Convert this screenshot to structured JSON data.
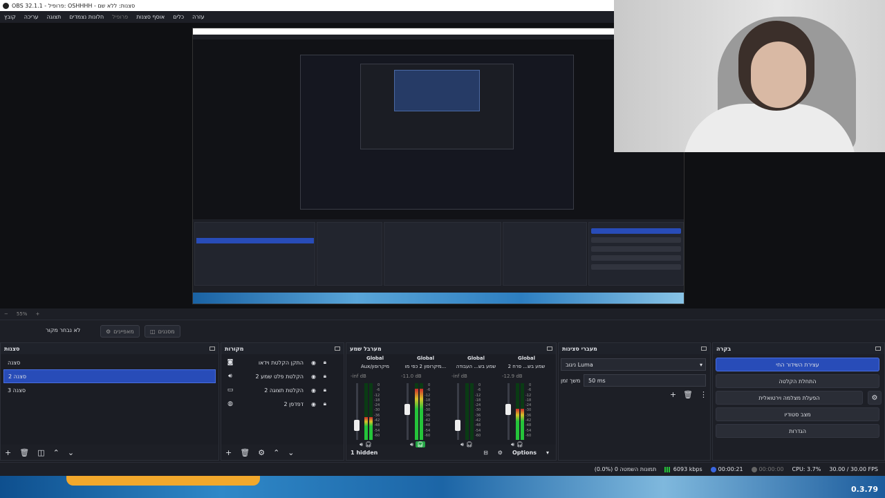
{
  "window": {
    "title": "OBS 32.1.1 - פרופיל: OSHHHH - סצנות: ללא שם"
  },
  "menu": {
    "items": [
      "קובץ",
      "עריכה",
      "תצוגה",
      "חלונות נצמדים",
      "פרופיל",
      "אוסף סצנות",
      "כלים",
      "עזרה"
    ]
  },
  "toolbar": {
    "no_source": "לא נבחר מקור",
    "properties": "מאפיינים",
    "filters": "מסננים"
  },
  "scenes": {
    "title": "סצנות",
    "items": [
      "סצנה",
      "סצנה 2",
      "סצנה 3"
    ],
    "selected_index": 1
  },
  "sources": {
    "title": "מקורות",
    "items": [
      {
        "label": "התקן הקלטת וידאו",
        "icon": "camera-icon"
      },
      {
        "label": "הקלטת פלט שמע 2",
        "icon": "speaker-icon"
      },
      {
        "label": "הקלטת תצוגה 2",
        "icon": "monitor-icon"
      },
      {
        "label": "דפדפן 2",
        "icon": "globe-icon"
      }
    ]
  },
  "mixer": {
    "title": "מערבל שמע",
    "channels": [
      {
        "global": "Global",
        "name": "Aux/מיקרופון",
        "db": "-inf dB",
        "level": 0.4,
        "volume": 0.2,
        "headphone_on": false
      },
      {
        "global": "Global",
        "name": "מיקרופון 2 כפי מו...",
        "db": "-11.0 dB",
        "level": 0.9,
        "volume": 0.55,
        "headphone_on": true
      },
      {
        "global": "Global",
        "name": "שמע בש... העבודה",
        "db": "-inf dB",
        "level": 0.0,
        "volume": 0.2,
        "headphone_on": false
      },
      {
        "global": "Global",
        "name": "שמע בש... פרח 2",
        "db": "-12.9 dB",
        "level": 0.55,
        "volume": 0.55,
        "headphone_on": false
      }
    ],
    "scale": [
      "0",
      "-6",
      "-12",
      "-18",
      "-24",
      "-30",
      "-36",
      "-42",
      "-48",
      "-54",
      "-60"
    ],
    "hidden": "1 hidden",
    "options": "Options"
  },
  "transitions": {
    "title": "מעברי סצינות",
    "selected": "ניגוב Luma",
    "duration_label": "משך זמן",
    "duration": "50 ms"
  },
  "controls": {
    "title": "בקרה",
    "buttons": [
      "עצירת השידור החי",
      "התחלת הקלטה",
      "הפעלת מצלמה וירטואלית",
      "מצב סטודיו",
      "הגדרות"
    ]
  },
  "status": {
    "dropped": "(0.0%) 0 תמונות השמטה",
    "bitrate": "6093 kbps",
    "stream_time": "00:00:21",
    "rec_time": "00:00:00",
    "cpu": "CPU: 3.7%",
    "fps": "30.00 / 30.00 FPS"
  },
  "preview": {
    "zoom": "55%"
  },
  "game": {
    "version": "0.3.79"
  },
  "colors": {
    "accent": "#284cb8",
    "panel": "#1d1f26",
    "meter_green": "#25c43a"
  }
}
